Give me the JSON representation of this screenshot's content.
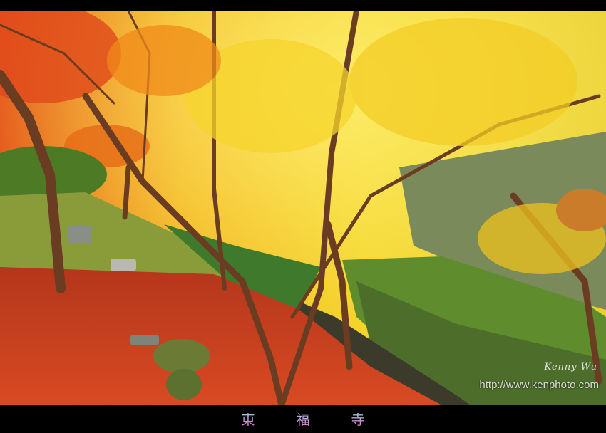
{
  "photo": {
    "subject": "autumn maple trees",
    "colors": {
      "yellow": "#f2c21a",
      "orange": "#e86a14",
      "red": "#c8321c",
      "moss": "#6a8a2a",
      "stone": "#6f7560"
    }
  },
  "watermark": {
    "signature": "Kenny Wu",
    "url": "http://www.kenphoto.com"
  },
  "caption": "東 福 寺"
}
